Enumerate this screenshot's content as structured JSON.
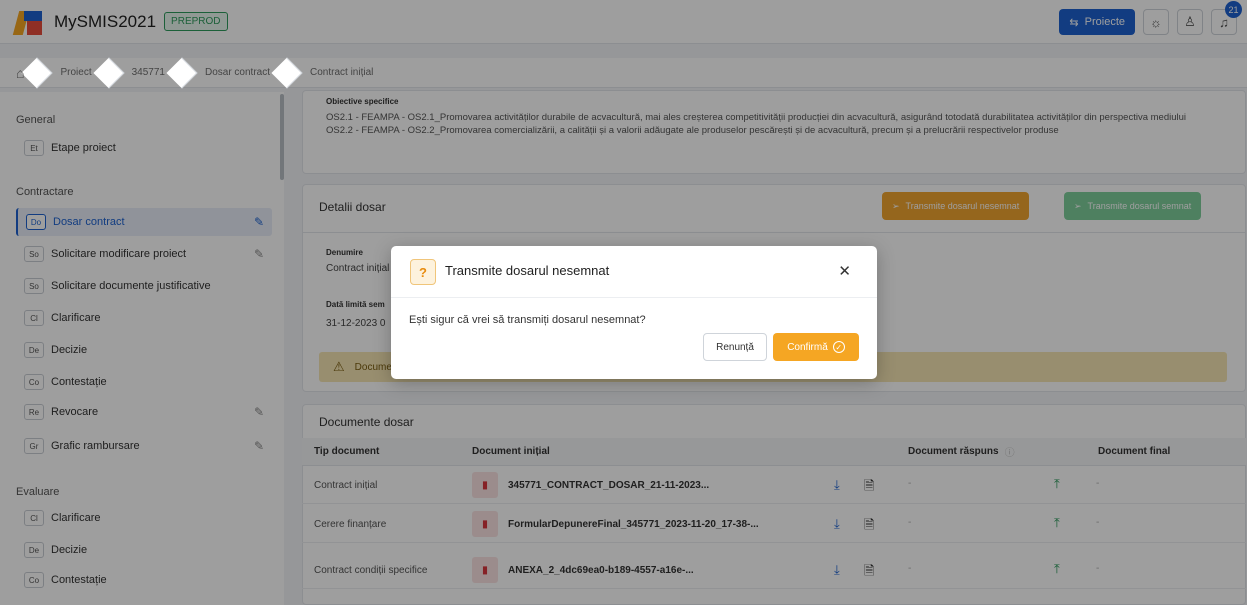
{
  "header": {
    "app_name": "MySMIS2021",
    "env_badge": "PREPROD",
    "projects_label": "Proiecte",
    "notifications_count": "21"
  },
  "breadcrumb": [
    "Proiect",
    "345771",
    "Dosar contract",
    "Contract inițial"
  ],
  "sidebar": {
    "sections": [
      {
        "title": "General",
        "items": [
          {
            "abbr": "Et",
            "label": "Etape proiect"
          }
        ]
      },
      {
        "title": "Contractare",
        "items": [
          {
            "abbr": "Do",
            "label": "Dosar contract",
            "edit": true,
            "active": true
          },
          {
            "abbr": "So",
            "label": "Solicitare modificare proiect",
            "edit": true
          },
          {
            "abbr": "So",
            "label": "Solicitare documente justificative"
          },
          {
            "abbr": "Cl",
            "label": "Clarificare"
          },
          {
            "abbr": "De",
            "label": "Decizie"
          },
          {
            "abbr": "Co",
            "label": "Contestație"
          },
          {
            "abbr": "Re",
            "label": "Revocare",
            "edit": true
          },
          {
            "abbr": "Gr",
            "label": "Grafic rambursare",
            "edit": true
          }
        ]
      },
      {
        "title": "Evaluare",
        "items": [
          {
            "abbr": "Cl",
            "label": "Clarificare"
          },
          {
            "abbr": "De",
            "label": "Decizie"
          },
          {
            "abbr": "Co",
            "label": "Contestație"
          }
        ]
      }
    ]
  },
  "objectives": {
    "title": "Obiective specifice",
    "lines": [
      "OS2.1 - FEAMPA - OS2.1_Promovarea activităților durabile de acvacultură, mai ales creșterea competitivității producției din acvacultură, asigurând totodată durabilitatea activităților din perspectiva mediului",
      "OS2.2 - FEAMPA - OS2.2_Promovarea comercializării, a calității și a valorii adăugate ale produselor pescărești și de acvacultură, precum și a prelucrării respectivelor produse"
    ]
  },
  "details": {
    "title": "Detalii dosar",
    "btn_unsigned": "Transmite dosarul nesemnat",
    "btn_signed": "Transmite dosarul semnat",
    "name_label": "Denumire",
    "name_value": "Contract inițial",
    "deadline_label": "Dată limită sem",
    "deadline_value": "31-12-2023 0",
    "warning": "Docume"
  },
  "documents": {
    "title": "Documente dosar",
    "columns": [
      "Tip document",
      "Document inițial",
      "Document răspuns",
      "Document final"
    ],
    "rows": [
      {
        "type": "Contract inițial",
        "file": "345771_CONTRACT_DOSAR_21-11-2023...",
        "response": "-",
        "final": "-"
      },
      {
        "type": "Cerere finanțare",
        "file": "FormularDepunereFinal_345771_2023-11-20_17-38-...",
        "response": "-",
        "final": "-"
      },
      {
        "type": "Contract condiții specifice",
        "file": "ANEXA_2_4dc69ea0-b189-4557-a16e-...",
        "response": "-",
        "final": "-"
      }
    ]
  },
  "modal": {
    "title": "Transmite dosarul nesemnat",
    "message": "Ești sigur că vrei să transmiți dosarul nesemnat?",
    "cancel": "Renunță",
    "confirm": "Confirmă"
  }
}
